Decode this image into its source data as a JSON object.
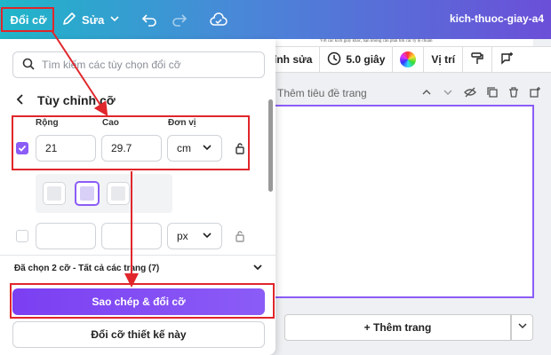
{
  "topbar": {
    "resize_label": "Đổi cỡ",
    "edit_label": "Sửa",
    "doc_title": "kich-thuoc-giay-a4"
  },
  "doc_preview_text": "Với các kích giấy khác, bạn không cần phải tìm các tỷ lệ chuẩn",
  "context_toolbar": {
    "edit_label": "ỉnh sửa",
    "duration_label": "5.0 giây",
    "position_label": "Vị trí"
  },
  "page_header": {
    "title_placeholder": "Thêm tiêu đề trang"
  },
  "add_page_label": "+ Thêm trang",
  "panel": {
    "search_placeholder": "Tìm kiếm các tùy chọn đổi cỡ",
    "section_title": "Tùy chỉnh cỡ",
    "labels": {
      "width": "Rộng",
      "height": "Cao",
      "unit": "Đơn vị"
    },
    "row1": {
      "width": "21",
      "height": "29.7",
      "unit": "cm"
    },
    "row2": {
      "width": "",
      "height": "",
      "unit": "px"
    },
    "selected_summary": "Đã chọn 2 cỡ - Tất cả các trang (7)",
    "copy_resize_button": "Sao chép & đổi cỡ",
    "resize_design_button": "Đổi cỡ thiết kế này"
  },
  "colors": {
    "accent": "#8b5cf6",
    "annotation": "#e0262b",
    "topbar_start": "#1fb6c9",
    "topbar_end": "#6b4fd8"
  },
  "icons": [
    "pencil-icon",
    "undo-icon",
    "redo-icon",
    "cloud-check-icon",
    "search-icon",
    "back-arrow-icon",
    "lock-icon",
    "clock-icon",
    "color-wheel-icon",
    "paint-roller-icon",
    "comment-add-icon",
    "chevron-down-icon"
  ]
}
